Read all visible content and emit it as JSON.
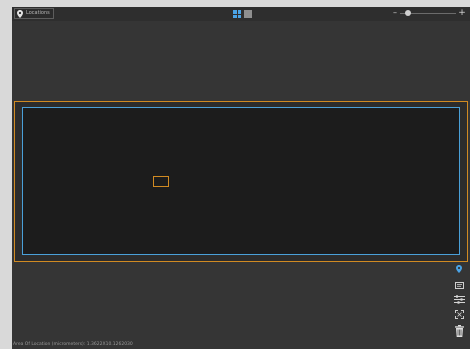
{
  "toolbar": {
    "location_tab_label": "Locations",
    "location_icon": "map-pin-icon",
    "view_grid_icon": "grid-view-icon",
    "view_single_icon": "single-view-icon",
    "zoom_minus_label": "–",
    "zoom_plus_label": "+",
    "zoom_level": 0.15
  },
  "side_tools": [
    {
      "name": "location-pin-tool",
      "icon": "map-pin-icon",
      "active": true
    },
    {
      "name": "comment-tool",
      "icon": "comment-icon",
      "active": false
    },
    {
      "name": "settings-tool",
      "icon": "sliders-icon",
      "active": false
    },
    {
      "name": "fit-tool",
      "icon": "expand-icon",
      "active": false
    },
    {
      "name": "delete-tool",
      "icon": "trash-icon",
      "active": false
    }
  ],
  "status_bar": {
    "text": "Area Of Location (micrometers): 1.3622X10.1262030"
  },
  "colors": {
    "accent_blue": "#4aa3e6",
    "frame_orange": "#d08a22",
    "panel": "#353535"
  }
}
